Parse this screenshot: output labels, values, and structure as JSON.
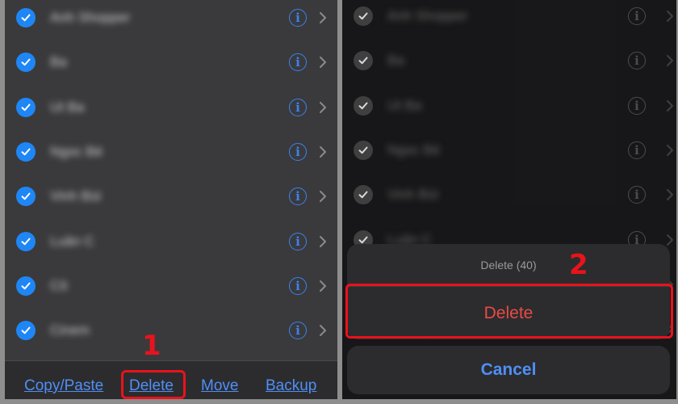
{
  "contacts": [
    {
      "name": "Anh Shopper"
    },
    {
      "name": "Ba"
    },
    {
      "name": "Ut Ba"
    },
    {
      "name": "Ngoc Bé"
    },
    {
      "name": "Vinh Bùi"
    },
    {
      "name": "Luân C"
    },
    {
      "name": "Cô"
    },
    {
      "name": "Cinem"
    }
  ],
  "toolbar": {
    "copy_paste_label": "Copy/Paste",
    "delete_label": "Delete",
    "move_label": "Move",
    "backup_label": "Backup"
  },
  "action_sheet": {
    "title": "Delete (40)",
    "delete_label": "Delete",
    "cancel_label": "Cancel"
  },
  "annotations": {
    "step1": "1",
    "step2": "2"
  },
  "icons": {
    "selected": "checkmark-circle-icon",
    "info": "info-circle-icon",
    "disclosure": "chevron-right-icon"
  },
  "colors": {
    "accent": "#1f86f5",
    "destructive": "#ea4a45",
    "annotation": "#e8131c"
  }
}
